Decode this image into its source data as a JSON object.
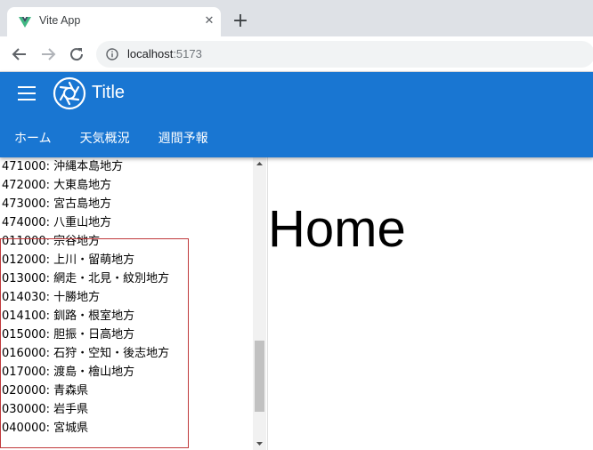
{
  "browser": {
    "tab_title": "Vite App",
    "url_host": "localhost",
    "url_port": ":5173"
  },
  "appbar": {
    "title": "Title",
    "tabs": [
      {
        "label": "ホーム"
      },
      {
        "label": "天気概況"
      },
      {
        "label": "週間予報"
      }
    ]
  },
  "regions": [
    {
      "text": "471000: 沖縄本島地方"
    },
    {
      "text": "472000: 大東島地方"
    },
    {
      "text": "473000: 宮古島地方"
    },
    {
      "text": "474000: 八重山地方"
    },
    {
      "text": "011000: 宗谷地方"
    },
    {
      "text": "012000: 上川・留萌地方"
    },
    {
      "text": "013000: 網走・北見・紋別地方"
    },
    {
      "text": "014030: 十勝地方"
    },
    {
      "text": "014100: 釧路・根室地方"
    },
    {
      "text": "015000: 胆振・日高地方"
    },
    {
      "text": "016000: 石狩・空知・後志地方"
    },
    {
      "text": "017000: 渡島・檜山地方"
    },
    {
      "text": "020000: 青森県"
    },
    {
      "text": "030000: 岩手県"
    },
    {
      "text": "040000: 宮城県"
    }
  ],
  "main": {
    "heading": "Home"
  },
  "colors": {
    "appbar": "#1976d2",
    "highlight_border": "#c0393b"
  }
}
